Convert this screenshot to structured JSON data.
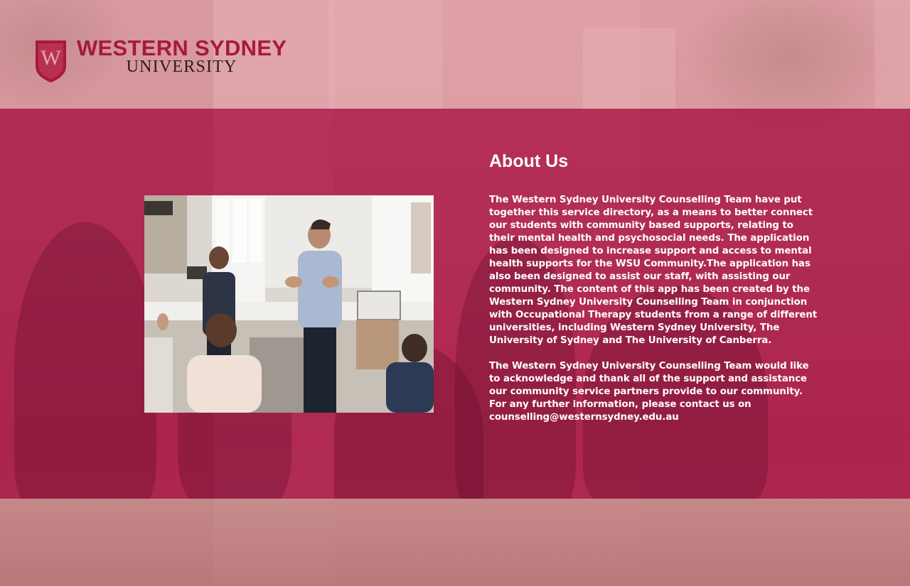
{
  "logo": {
    "shield_letter": "W",
    "line1": "WESTERN SYDNEY",
    "line2": "UNIVERSITY",
    "brand_color": "#a6193c"
  },
  "about": {
    "title": "About Us",
    "paragraph1": "The Western Sydney University Counselling Team have put together this service directory, as a means to better connect our students with community based supports, relating to their mental health and psychosocial needs. The application has been designed to increase support and access to mental health supports for the WSU Community.The application has also been designed to assist our staff, with assisting our community. The content of this app has been created by the Western Sydney University Counselling Team in conjunction with Occupational Therapy students from a range of different universities, including Western Sydney University, The University of Sydney and The University of Canberra.",
    "paragraph2": "The Western Sydney University Counselling Team would like to acknowledge and thank all of the support and assistance our community service partners provide to our community. For any further information, please contact us on counselling@westernsydney.edu.au"
  },
  "colors": {
    "band_overlay": "#aa1244",
    "header_tint": "#e8a0aa",
    "text": "#ffffff"
  }
}
